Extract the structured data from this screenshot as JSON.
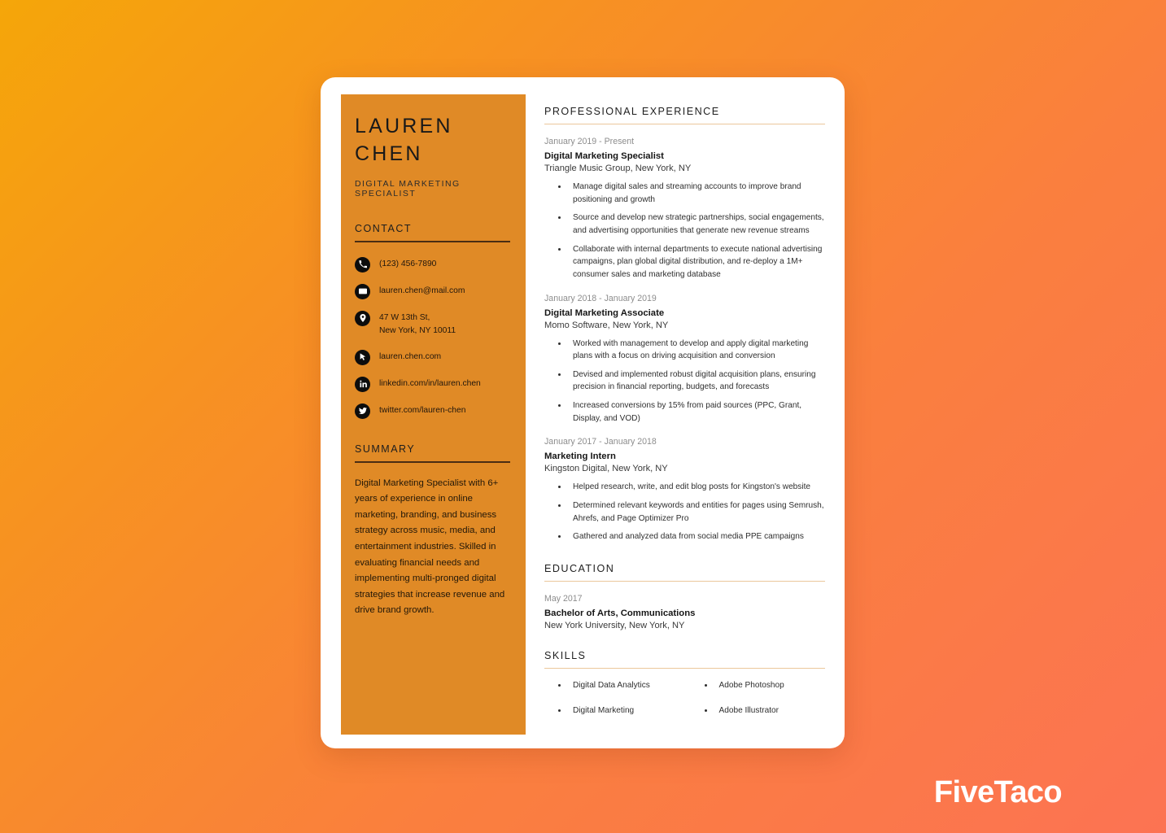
{
  "brand": {
    "logo_text": "FiveTaco"
  },
  "theme": {
    "background_start": "#F5A609",
    "background_end": "#FC7353",
    "sidebar_bg": "#E08A26",
    "card_bg": "#FFFFFF",
    "sidebar_rule": "#4A2D13",
    "main_rule": "#EBC79B",
    "date_text": "#8D8D8D"
  },
  "sidebar": {
    "name_first": "LAUREN",
    "name_last": "CHEN",
    "job_title": "DIGITAL MARKETING SPECIALIST",
    "contact_heading": "CONTACT",
    "contacts": [
      {
        "icon": "phone-icon",
        "line1": "(123) 456-7890",
        "line2": ""
      },
      {
        "icon": "envelope-icon",
        "line1": "lauren.chen@mail.com",
        "line2": ""
      },
      {
        "icon": "location-pin-icon",
        "line1": "47 W 13th St,",
        "line2": "New York, NY 10011"
      },
      {
        "icon": "cursor-icon",
        "line1": "lauren.chen.com",
        "line2": ""
      },
      {
        "icon": "linkedin-icon",
        "line1": "linkedin.com/in/lauren.chen",
        "line2": ""
      },
      {
        "icon": "twitter-icon",
        "line1": "twitter.com/lauren-chen",
        "line2": ""
      }
    ],
    "summary_heading": "SUMMARY",
    "summary_text": "Digital Marketing Specialist with 6+ years of experience in online marketing, branding, and business strategy across music, media, and entertainment industries. Skilled in evaluating financial needs and implementing multi-pronged digital strategies that increase revenue and drive brand growth."
  },
  "main": {
    "experience_heading": "PROFESSIONAL EXPERIENCE",
    "experience": [
      {
        "date": "January 2019 - Present",
        "title": "Digital Marketing Specialist",
        "org": "Triangle Music Group,  New York, NY",
        "bullets": [
          "Manage digital sales and streaming accounts to improve brand positioning and growth",
          "Source and develop new strategic partnerships, social engagements, and advertising opportunities that generate new revenue streams",
          "Collaborate with internal departments to execute national advertising campaigns, plan global digital distribution, and re-deploy a 1M+ consumer sales and marketing database"
        ]
      },
      {
        "date": "January 2018 - January 2019",
        "title": "Digital Marketing Associate",
        "org": "Momo Software,  New York, NY",
        "bullets": [
          "Worked with management to develop and apply digital marketing plans with a focus on driving acquisition and conversion",
          "Devised and implemented robust digital acquisition plans, ensuring precision in financial reporting, budgets, and forecasts",
          "Increased conversions by 15% from paid sources (PPC, Grant, Display, and VOD)"
        ]
      },
      {
        "date": "January 2017 -  January 2018",
        "title": "Marketing Intern",
        "org": "Kingston Digital,  New York, NY",
        "bullets": [
          "Helped research, write, and edit blog posts for Kingston's website",
          "Determined relevant keywords and entities for pages using Semrush, Ahrefs, and Page Optimizer Pro",
          "Gathered and analyzed data from social media PPE campaigns"
        ]
      }
    ],
    "education_heading": "EDUCATION",
    "education": [
      {
        "date": "May 2017",
        "title": "Bachelor of Arts, Communications",
        "org": "New York University,  New York, NY"
      }
    ],
    "skills_heading": "SKILLS",
    "skills_left": [
      "Digital Data Analytics",
      "Digital Marketing"
    ],
    "skills_right": [
      "Adobe Photoshop",
      "Adobe Illustrator"
    ]
  }
}
